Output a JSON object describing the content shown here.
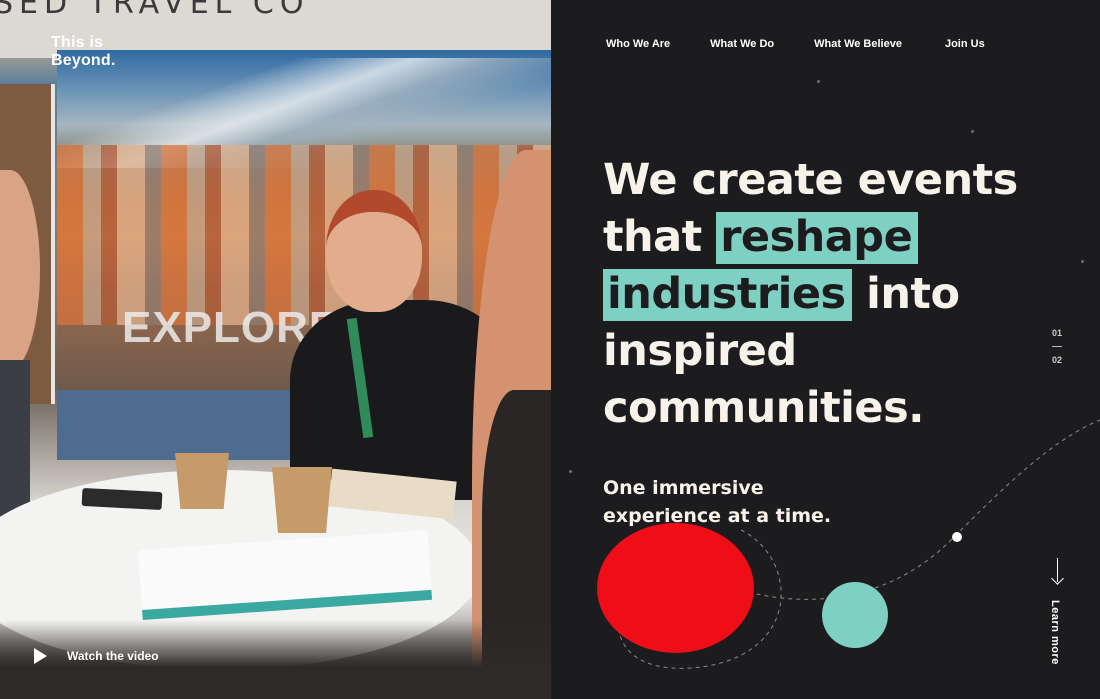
{
  "hero_image": {
    "banner_text": "SED TRAVEL CO",
    "poster_text": "EXPLORE",
    "logo": {
      "line1": "This is",
      "line2": "Beyond."
    },
    "watch_video_label": "Watch the video"
  },
  "nav": {
    "items": [
      {
        "label": "Who We Are"
      },
      {
        "label": "What We Do"
      },
      {
        "label": "What We Believe"
      },
      {
        "label": "Join Us"
      }
    ]
  },
  "headline": {
    "line1": "We create events",
    "line2_plain": "that ",
    "line2_highlight": "reshape",
    "line3_highlight": "industries",
    "line3_plain": " into",
    "line4": "inspired",
    "line5": "communities."
  },
  "subheadline": {
    "line1": "One immersive",
    "line2": "experience at a time."
  },
  "pager": {
    "current": "01",
    "total": "02"
  },
  "learn_more": {
    "label": "Learn more"
  },
  "colors": {
    "background": "#1c1b1d",
    "highlight": "#7ed0c3",
    "red": "#ef0d18",
    "text": "#f7f3ea"
  }
}
